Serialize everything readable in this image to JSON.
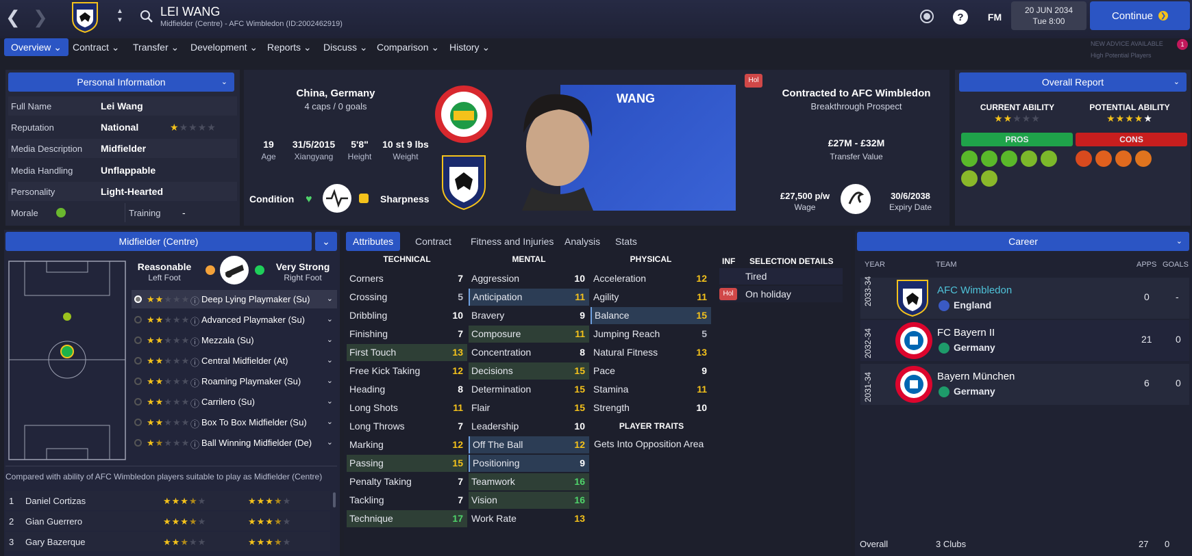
{
  "header": {
    "player_name": "LEI WANG",
    "subtitle": "Midfielder (Centre) - AFC Wimbledon (ID:2002462919)",
    "date": "20 JUN 2034",
    "time": "Tue 8:00",
    "continue_label": "Continue",
    "fm_label": "FM",
    "help_label": "?",
    "advice_line1": "NEW ADVICE AVAILABLE",
    "advice_line2": "High Potential Players",
    "advice_count": "1"
  },
  "menu": [
    {
      "label": "Overview"
    },
    {
      "label": "Contract"
    },
    {
      "label": "Transfer"
    },
    {
      "label": "Development"
    },
    {
      "label": "Reports"
    },
    {
      "label": "Discuss"
    },
    {
      "label": "Comparison"
    },
    {
      "label": "History"
    }
  ],
  "personal": {
    "title": "Personal Information",
    "rows": [
      {
        "label": "Full Name",
        "value": "Lei Wang"
      },
      {
        "label": "Reputation",
        "value": "National"
      },
      {
        "label": "Media Description",
        "value": "Midfielder"
      },
      {
        "label": "Media Handling",
        "value": "Unflappable"
      },
      {
        "label": "Personality",
        "value": "Light-Hearted"
      }
    ],
    "morale_label": "Morale",
    "training_label": "Training",
    "training_value": "-",
    "reputation_stars": 1
  },
  "bio": {
    "nations": "China, Germany",
    "caps": "4 caps / 0 goals",
    "age": "19",
    "age_label": "Age",
    "dob": "31/5/2015",
    "birthplace": "Xiangyang",
    "height": "5'8\"",
    "height_label": "Height",
    "weight": "10 st 9 lbs",
    "weight_label": "Weight",
    "condition_label": "Condition",
    "sharpness_label": "Sharpness",
    "shirt_name": "WANG",
    "hol_badge": "Hol"
  },
  "contract": {
    "title": "Contracted to AFC Wimbledon",
    "status": "Breakthrough Prospect",
    "value": "£27M - £32M",
    "value_label": "Transfer Value",
    "wage": "£27,500 p/w",
    "wage_label": "Wage",
    "expiry": "30/6/2038",
    "expiry_label": "Expiry Date"
  },
  "report": {
    "title": "Overall Report",
    "ca_label": "CURRENT ABILITY",
    "pa_label": "POTENTIAL ABILITY",
    "ca_stars": 2,
    "pa_stars": 4,
    "pros_label": "PROS",
    "cons_label": "CONS"
  },
  "position": {
    "title": "Midfielder (Centre)",
    "left_foot": "Reasonable",
    "left_foot_label": "Left Foot",
    "right_foot": "Very Strong",
    "right_foot_label": "Right Foot",
    "roles": [
      {
        "name": "Deep Lying Playmaker (Su)",
        "stars": 2
      },
      {
        "name": "Advanced Playmaker (Su)",
        "stars": 2
      },
      {
        "name": "Mezzala (Su)",
        "stars": 2
      },
      {
        "name": "Central Midfielder (At)",
        "stars": 2
      },
      {
        "name": "Roaming Playmaker (Su)",
        "stars": 2
      },
      {
        "name": "Carrilero (Su)",
        "stars": 2
      },
      {
        "name": "Box To Box Midfielder (Su)",
        "stars": 2
      },
      {
        "name": "Ball Winning Midfielder (De)",
        "stars": 1.5
      }
    ],
    "compare_text": "Compared with ability of AFC Wimbledon players suitable to play as Midfielder (Centre)",
    "compare": [
      {
        "rank": "1",
        "name": "Daniel Cortizas",
        "a": 3.5,
        "b": 3.5
      },
      {
        "rank": "2",
        "name": "Gian Guerrero",
        "a": 3.5,
        "b": 3.5
      },
      {
        "rank": "3",
        "name": "Gary Bazerque",
        "a": 2.5,
        "b": 3.5
      }
    ]
  },
  "tabs": [
    {
      "label": "Attributes"
    },
    {
      "label": "Contract"
    },
    {
      "label": "Fitness and Injuries"
    },
    {
      "label": "Analysis"
    },
    {
      "label": "Stats"
    }
  ],
  "attributes": {
    "technical_label": "TECHNICAL",
    "mental_label": "MENTAL",
    "physical_label": "PHYSICAL",
    "technical": [
      {
        "name": "Corners",
        "value": "7",
        "c": "w"
      },
      {
        "name": "Crossing",
        "value": "5",
        "c": "gr"
      },
      {
        "name": "Dribbling",
        "value": "10",
        "c": "w"
      },
      {
        "name": "Finishing",
        "value": "7",
        "c": "w"
      },
      {
        "name": "First Touch",
        "value": "13",
        "c": "y",
        "hl": "green"
      },
      {
        "name": "Free Kick Taking",
        "value": "12",
        "c": "y"
      },
      {
        "name": "Heading",
        "value": "8",
        "c": "w"
      },
      {
        "name": "Long Shots",
        "value": "11",
        "c": "y"
      },
      {
        "name": "Long Throws",
        "value": "7",
        "c": "w"
      },
      {
        "name": "Marking",
        "value": "12",
        "c": "y"
      },
      {
        "name": "Passing",
        "value": "15",
        "c": "y",
        "hl": "green"
      },
      {
        "name": "Penalty Taking",
        "value": "7",
        "c": "w"
      },
      {
        "name": "Tackling",
        "value": "7",
        "c": "w"
      },
      {
        "name": "Technique",
        "value": "17",
        "c": "g",
        "hl": "green"
      }
    ],
    "mental": [
      {
        "name": "Aggression",
        "value": "10",
        "c": "w"
      },
      {
        "name": "Anticipation",
        "value": "11",
        "c": "y",
        "hl": "blue"
      },
      {
        "name": "Bravery",
        "value": "9",
        "c": "w"
      },
      {
        "name": "Composure",
        "value": "11",
        "c": "y",
        "hl": "green"
      },
      {
        "name": "Concentration",
        "value": "8",
        "c": "w"
      },
      {
        "name": "Decisions",
        "value": "15",
        "c": "y",
        "hl": "green"
      },
      {
        "name": "Determination",
        "value": "15",
        "c": "y"
      },
      {
        "name": "Flair",
        "value": "15",
        "c": "y"
      },
      {
        "name": "Leadership",
        "value": "10",
        "c": "w"
      },
      {
        "name": "Off The Ball",
        "value": "12",
        "c": "y",
        "hl": "blue"
      },
      {
        "name": "Positioning",
        "value": "9",
        "c": "w",
        "hl": "blue"
      },
      {
        "name": "Teamwork",
        "value": "16",
        "c": "g",
        "hl": "green"
      },
      {
        "name": "Vision",
        "value": "16",
        "c": "g",
        "hl": "green"
      },
      {
        "name": "Work Rate",
        "value": "13",
        "c": "y"
      }
    ],
    "physical": [
      {
        "name": "Acceleration",
        "value": "12",
        "c": "y"
      },
      {
        "name": "Agility",
        "value": "11",
        "c": "y"
      },
      {
        "name": "Balance",
        "value": "15",
        "c": "y",
        "hl": "blue"
      },
      {
        "name": "Jumping Reach",
        "value": "5",
        "c": "gr"
      },
      {
        "name": "Natural Fitness",
        "value": "13",
        "c": "y"
      },
      {
        "name": "Pace",
        "value": "9",
        "c": "w"
      },
      {
        "name": "Stamina",
        "value": "11",
        "c": "y"
      },
      {
        "name": "Strength",
        "value": "10",
        "c": "w"
      }
    ],
    "traits_label": "PLAYER TRAITS",
    "traits": [
      "Gets Into Opposition Area"
    ]
  },
  "selection": {
    "inf_label": "INF",
    "title": "SELECTION DETAILS",
    "items": [
      {
        "badge": "",
        "text": "Tired"
      },
      {
        "badge": "Hol",
        "text": "On holiday"
      }
    ]
  },
  "career": {
    "title": "Career",
    "year_label": "YEAR",
    "team_label": "TEAM",
    "apps_label": "APPS",
    "goals_label": "GOALS",
    "rows": [
      {
        "year": "2033-34",
        "team": "AFC Wimbledon",
        "country": "England",
        "apps": "0",
        "goals": "-",
        "link": true
      },
      {
        "year": "2032-34",
        "team": "FC Bayern II",
        "country": "Germany",
        "apps": "21",
        "goals": "0"
      },
      {
        "year": "2031-34",
        "team": "Bayern München",
        "country": "Germany",
        "apps": "6",
        "goals": "0"
      }
    ],
    "overall_label": "Overall",
    "overall_clubs": "3 Clubs",
    "overall_apps": "27",
    "overall_goals": "0"
  },
  "colors": {
    "accent": "#2b55c4",
    "pros": "#1fa34a",
    "cons": "#c81e1e",
    "gold": "#f4c21b"
  }
}
